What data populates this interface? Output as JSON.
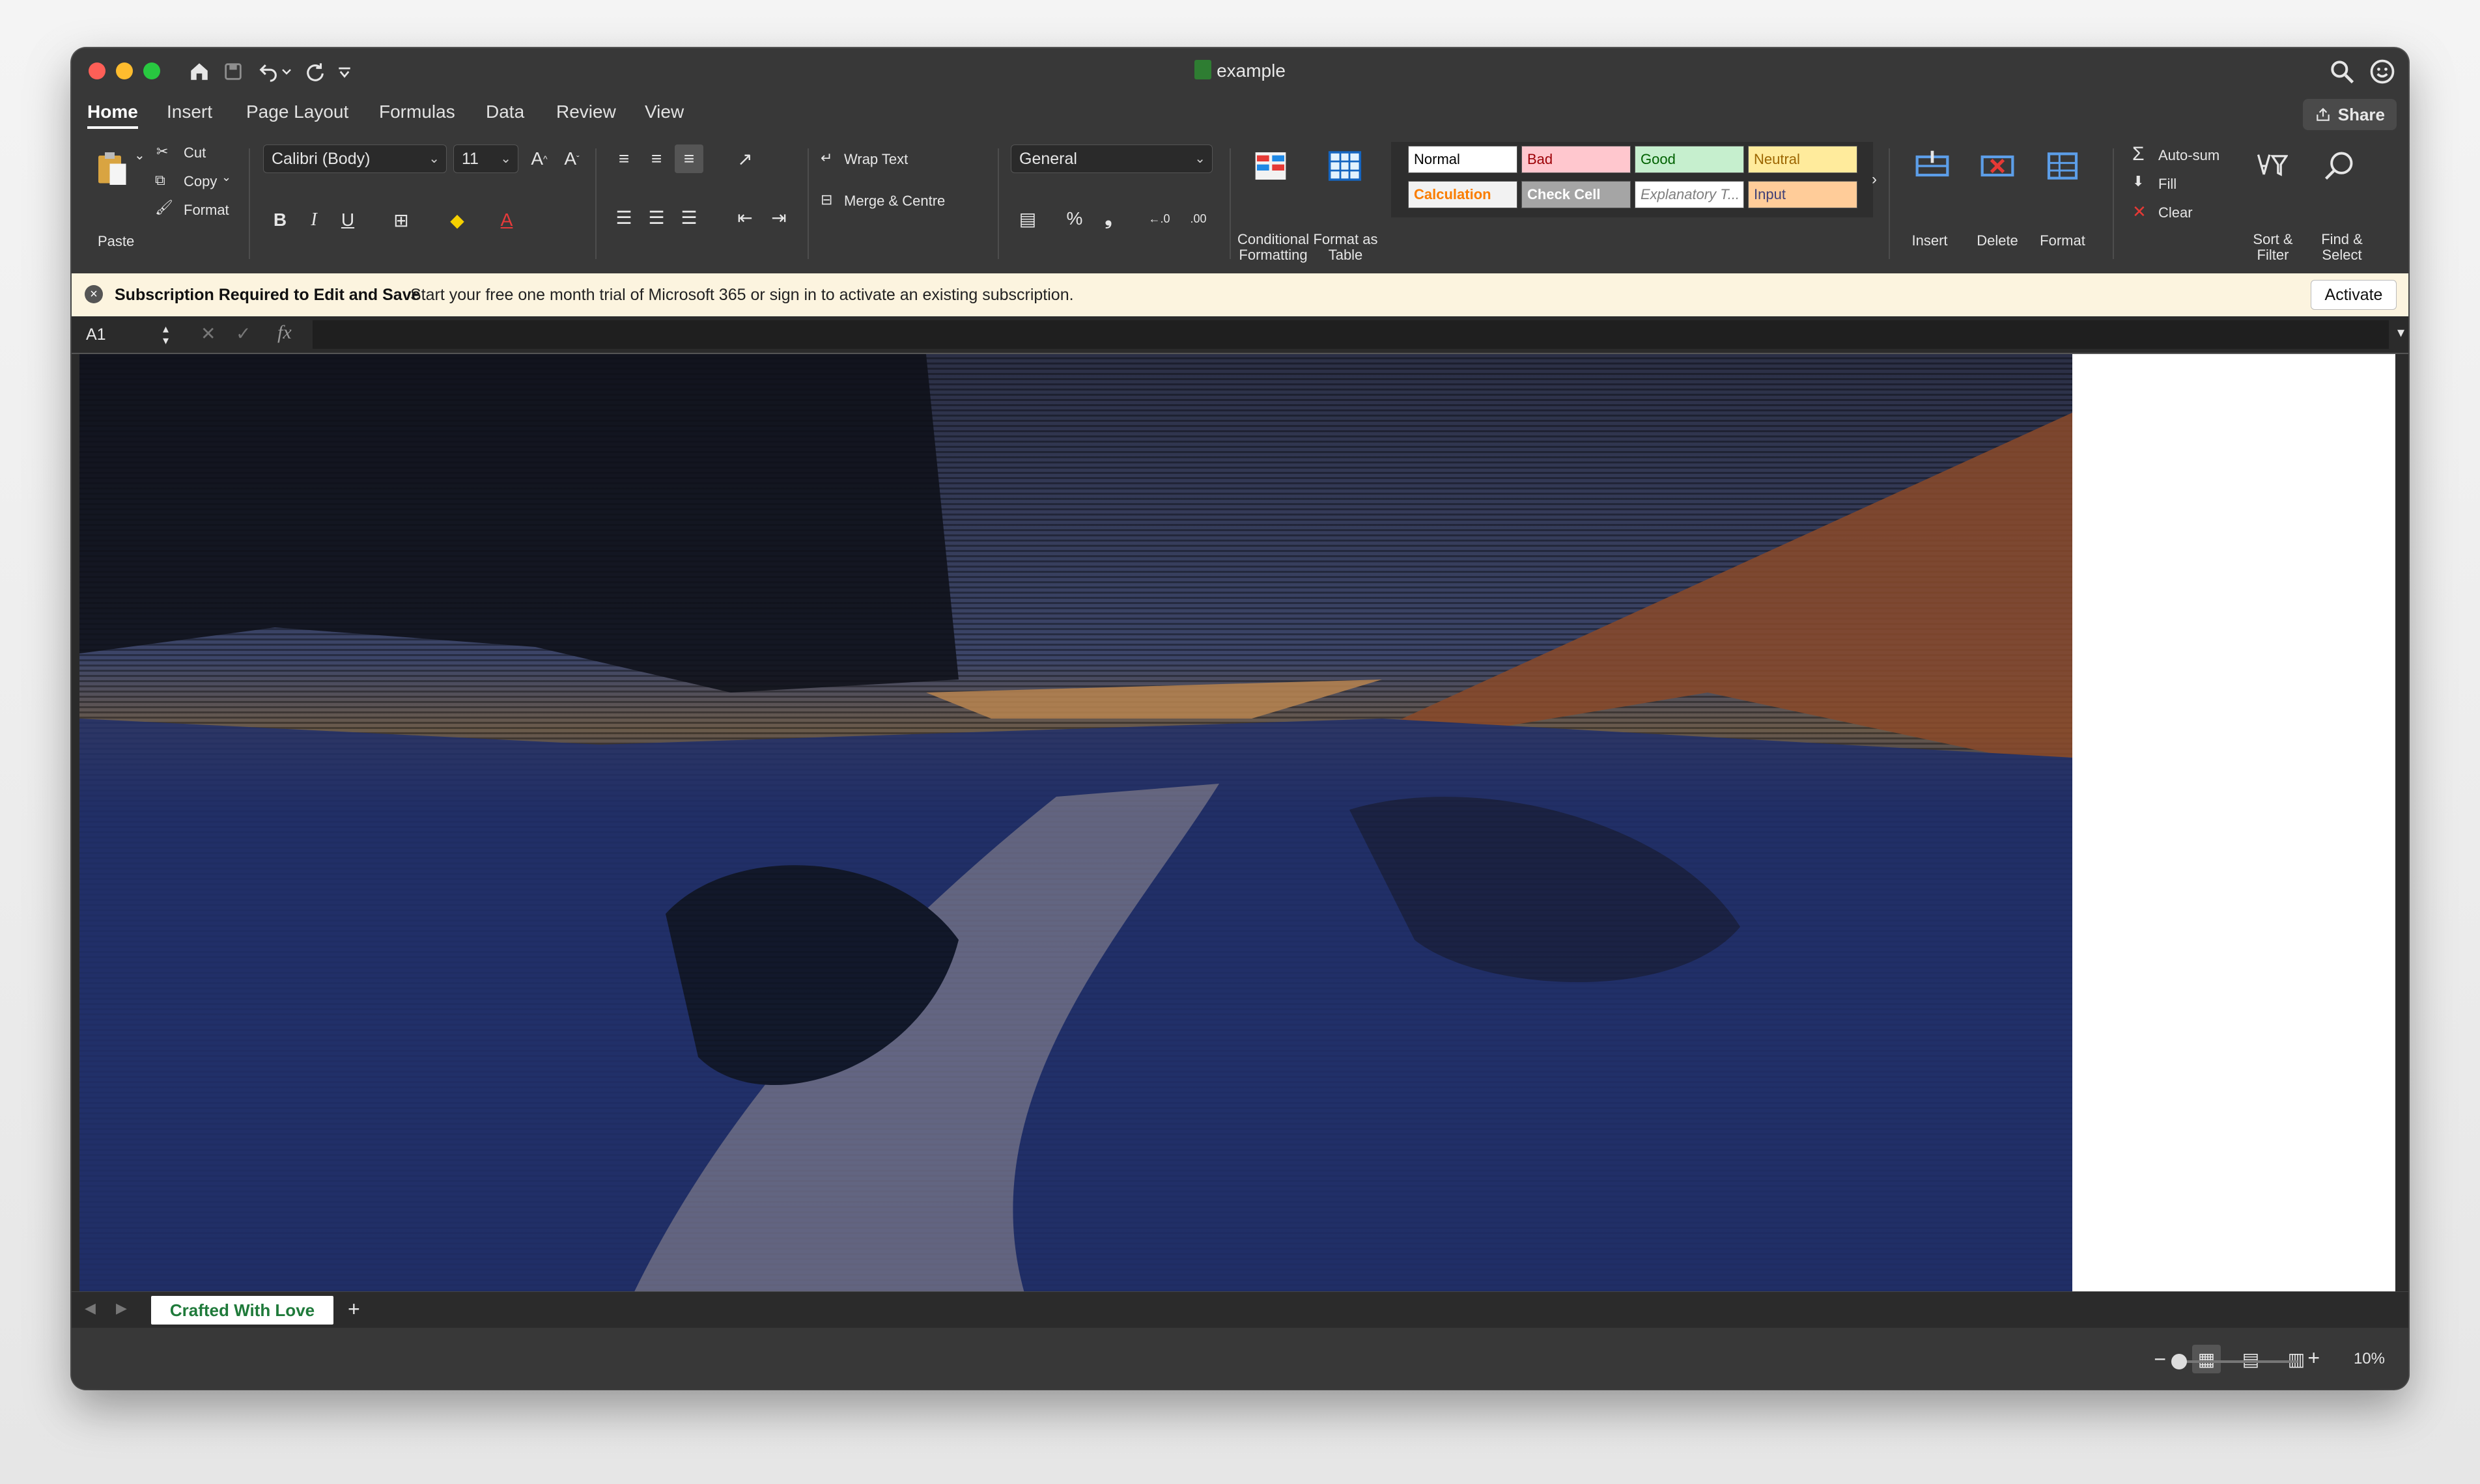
{
  "window": {
    "title": "example"
  },
  "tabs": [
    "Home",
    "Insert",
    "Page Layout",
    "Formulas",
    "Data",
    "Review",
    "View"
  ],
  "share_label": "Share",
  "clipboard": {
    "paste": "Paste",
    "cut": "Cut",
    "copy": "Copy",
    "format": "Format"
  },
  "font": {
    "name": "Calibri (Body)",
    "size": "11",
    "bold": "B",
    "italic": "I",
    "underline": "U"
  },
  "alignment": {
    "wrap": "Wrap Text",
    "merge": "Merge & Centre"
  },
  "number": {
    "format": "General",
    "percent": "%",
    "comma": "❟"
  },
  "styles_group": {
    "conditional": "Conditional Formatting",
    "format_table": "Format as Table"
  },
  "cell_styles": [
    {
      "label": "Normal",
      "bg": "#ffffff",
      "fg": "#000000"
    },
    {
      "label": "Bad",
      "bg": "#ffc7ce",
      "fg": "#9c0006"
    },
    {
      "label": "Good",
      "bg": "#c6efce",
      "fg": "#006100"
    },
    {
      "label": "Neutral",
      "bg": "#ffeb9c",
      "fg": "#9c6500"
    },
    {
      "label": "Calculation",
      "bg": "#f2f2f2",
      "fg": "#fa7d00"
    },
    {
      "label": "Check Cell",
      "bg": "#a5a5a5",
      "fg": "#ffffff"
    },
    {
      "label": "Explanatory T...",
      "bg": "#ffffff",
      "fg": "#7f7f7f"
    },
    {
      "label": "Input",
      "bg": "#ffcc99",
      "fg": "#3f3f76"
    }
  ],
  "cells_group": {
    "insert": "Insert",
    "delete": "Delete",
    "format": "Format"
  },
  "editing": {
    "autosum": "Auto-sum",
    "fill": "Fill",
    "clear": "Clear",
    "sort": "Sort & Filter",
    "find": "Find & Select"
  },
  "banner": {
    "title": "Subscription Required to Edit and Save",
    "message": "Start your free one month trial of Microsoft 365 or sign in to activate an existing subscription.",
    "button": "Activate"
  },
  "formula_bar": {
    "cell": "A1",
    "fx": "fx"
  },
  "sheet_tabs": [
    "Crafted With Love"
  ],
  "status": {
    "zoom": "10%"
  }
}
